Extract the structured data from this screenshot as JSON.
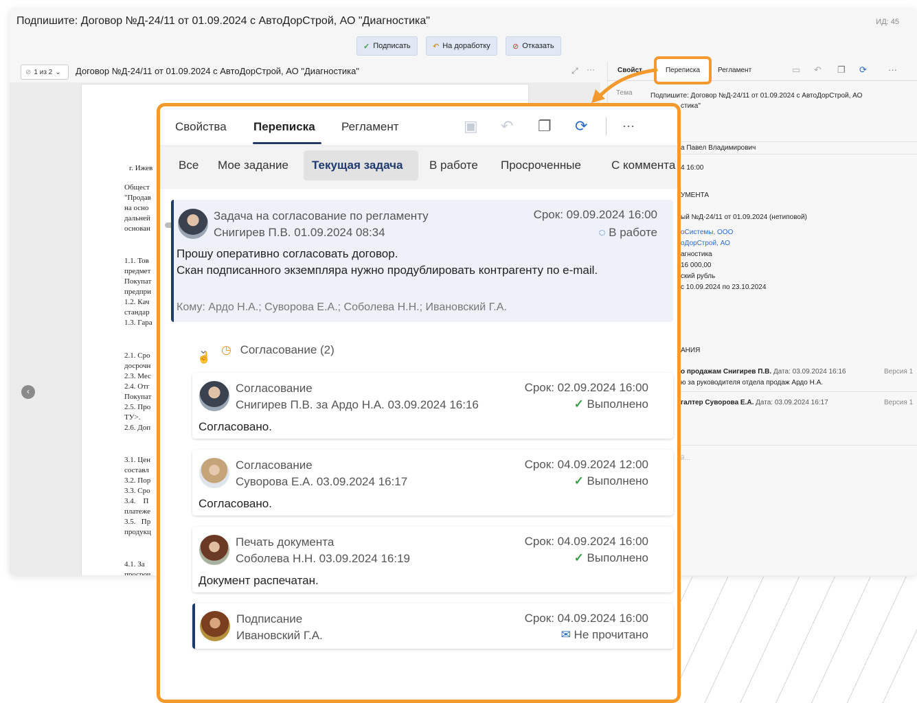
{
  "background_window": {
    "title": "Подпишите: Договор №Д-24/11 от 01.09.2024 с АвтоДорСтрой, АО \"Диагностика\"",
    "id_label": "ИД: 45",
    "actions": {
      "sign": "Подписать",
      "rework": "На доработку",
      "reject": "Отказать"
    },
    "pager": "1 из 2",
    "doc_name": "Договор №Д-24/11 от 01.09.2024 с АвтоДорСтрой, АО \"Диагностика\"",
    "right_tabs": {
      "props": "Свойст",
      "correspondence": "Переписка",
      "regulation": "Регламент"
    },
    "theme_label": "Тема",
    "theme_value": "Подпишите: Договор №Д-24/11 от 01.09.2024 с АвтоДорСтрой, АО",
    "theme_value2": "стика\"",
    "author": "а Павел Владимирович",
    "deadline": "4 16:00",
    "section_doc": "УМЕНТА",
    "doc_line": "ый №Д-24/11 от 01.09.2024 (нетиповой)",
    "org1": "оСистемы, ООО",
    "org2": "оДорСтрой, АО",
    "org3": "агностика",
    "amount": "16 000,00",
    "currency": "ский рубль",
    "period": "с 10.09.2024 по 23.10.2024",
    "section_sign": "АНИЯ",
    "sign1": "о продажам Снигирев П.В.",
    "sign1_date": "Дата: 03.09.2024 16:16",
    "sign1_ver": "Версия 1",
    "sign1_note": "ю за руководителя отдела продаж Ардо Н.А.",
    "sign2": "галтер Суворова Е.А.",
    "sign2_date": "Дата: 03.09.2024 16:17",
    "sign2_ver": "Версия 1",
    "placeholder": "й..."
  },
  "doc_fragments": {
    "city": "г. Ижев",
    "p1": "Общест\n\"Продав\nна осно\nдальней\nоснован",
    "p2": "1.1. Тов\nпредмет\nПокупат\nпредпри\n1.2. Кач\nстандар\n1.3. Гара",
    "p3": "2.1. Сро\nдосрочн\n2.3. Мес\n2.4. Отг\nПокупат\n2.5. Про\nТУ>.\n2.6. Доп",
    "p4": "3.1. Цен\nсоставл\n3.2. Пор\n3.3. Сро\n3.4.    П\nплатеже\n3.5.   Пр\nпродукц",
    "p5": "4.1. За \nпросроч"
  },
  "panel": {
    "tabs": {
      "props": "Свойства",
      "correspondence": "Переписка",
      "regulation": "Регламент"
    },
    "filters": [
      "Все",
      "Мое задание",
      "Текущая задача",
      "В работе",
      "Просроченные",
      "С коммента"
    ],
    "main_task": {
      "title": "Задача на согласование по регламенту",
      "author": "Снигирев П.В.  01.09.2024 08:34",
      "due": "Срок: 09.09.2024 16:00",
      "status": "В работе",
      "body1": "Прошу оперативно согласовать договор.",
      "body2": "Скан подписанного экземпляра нужно продублировать контрагенту по e-mail.",
      "to": "Кому: Ардо Н.А.; Суворова Е.А.; Соболева Н.Н.; Ивановский Г.А."
    },
    "group": {
      "label": "Согласование (2)"
    },
    "items": [
      {
        "title": "Согласование",
        "author": "Снигирев П.В. за Ардо Н.А.  03.09.2024 16:16",
        "due": "Срок: 02.09.2024 16:00",
        "status": "Выполнено",
        "body": "Согласовано."
      },
      {
        "title": "Согласование",
        "author": "Суворова Е.А.  03.09.2024 16:17",
        "due": "Срок: 04.09.2024 12:00",
        "status": "Выполнено",
        "body": "Согласовано."
      },
      {
        "title": "Печать документа",
        "author": "Соболева Н.Н.  03.09.2024 16:19",
        "due": "Срок: 04.09.2024 16:00",
        "status": "Выполнено",
        "body": "Документ распечатан."
      },
      {
        "title": "Подписание",
        "author": "Ивановский Г.А.",
        "due": "Срок: 04.09.2024 16:00",
        "status": "Не прочитано",
        "body": ""
      }
    ]
  },
  "colors": {
    "accent": "#f29a2e",
    "navy": "#1f3b6b",
    "done": "#3aa04a",
    "link": "#2d6ac4"
  }
}
